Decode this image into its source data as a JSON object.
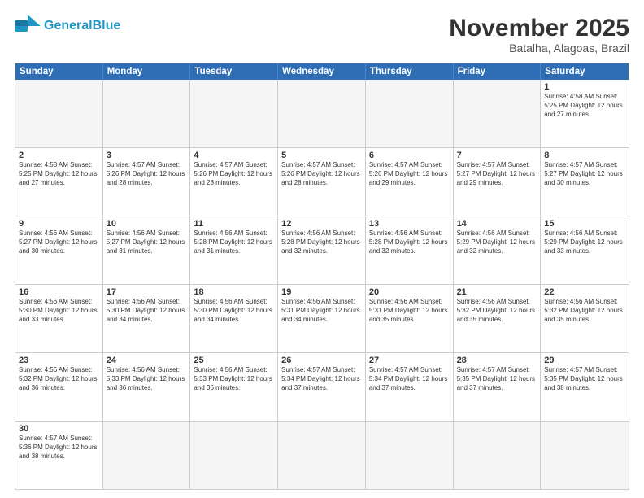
{
  "header": {
    "logo_general": "General",
    "logo_blue": "Blue",
    "month_year": "November 2025",
    "location": "Batalha, Alagoas, Brazil"
  },
  "weekdays": [
    "Sunday",
    "Monday",
    "Tuesday",
    "Wednesday",
    "Thursday",
    "Friday",
    "Saturday"
  ],
  "rows": [
    [
      {
        "day": "",
        "text": ""
      },
      {
        "day": "",
        "text": ""
      },
      {
        "day": "",
        "text": ""
      },
      {
        "day": "",
        "text": ""
      },
      {
        "day": "",
        "text": ""
      },
      {
        "day": "",
        "text": ""
      },
      {
        "day": "1",
        "text": "Sunrise: 4:58 AM\nSunset: 5:25 PM\nDaylight: 12 hours and 27 minutes."
      }
    ],
    [
      {
        "day": "2",
        "text": "Sunrise: 4:58 AM\nSunset: 5:25 PM\nDaylight: 12 hours and 27 minutes."
      },
      {
        "day": "3",
        "text": "Sunrise: 4:57 AM\nSunset: 5:26 PM\nDaylight: 12 hours and 28 minutes."
      },
      {
        "day": "4",
        "text": "Sunrise: 4:57 AM\nSunset: 5:26 PM\nDaylight: 12 hours and 28 minutes."
      },
      {
        "day": "5",
        "text": "Sunrise: 4:57 AM\nSunset: 5:26 PM\nDaylight: 12 hours and 28 minutes."
      },
      {
        "day": "6",
        "text": "Sunrise: 4:57 AM\nSunset: 5:26 PM\nDaylight: 12 hours and 29 minutes."
      },
      {
        "day": "7",
        "text": "Sunrise: 4:57 AM\nSunset: 5:27 PM\nDaylight: 12 hours and 29 minutes."
      },
      {
        "day": "8",
        "text": "Sunrise: 4:57 AM\nSunset: 5:27 PM\nDaylight: 12 hours and 30 minutes."
      }
    ],
    [
      {
        "day": "9",
        "text": "Sunrise: 4:56 AM\nSunset: 5:27 PM\nDaylight: 12 hours and 30 minutes."
      },
      {
        "day": "10",
        "text": "Sunrise: 4:56 AM\nSunset: 5:27 PM\nDaylight: 12 hours and 31 minutes."
      },
      {
        "day": "11",
        "text": "Sunrise: 4:56 AM\nSunset: 5:28 PM\nDaylight: 12 hours and 31 minutes."
      },
      {
        "day": "12",
        "text": "Sunrise: 4:56 AM\nSunset: 5:28 PM\nDaylight: 12 hours and 32 minutes."
      },
      {
        "day": "13",
        "text": "Sunrise: 4:56 AM\nSunset: 5:28 PM\nDaylight: 12 hours and 32 minutes."
      },
      {
        "day": "14",
        "text": "Sunrise: 4:56 AM\nSunset: 5:29 PM\nDaylight: 12 hours and 32 minutes."
      },
      {
        "day": "15",
        "text": "Sunrise: 4:56 AM\nSunset: 5:29 PM\nDaylight: 12 hours and 33 minutes."
      }
    ],
    [
      {
        "day": "16",
        "text": "Sunrise: 4:56 AM\nSunset: 5:30 PM\nDaylight: 12 hours and 33 minutes."
      },
      {
        "day": "17",
        "text": "Sunrise: 4:56 AM\nSunset: 5:30 PM\nDaylight: 12 hours and 34 minutes."
      },
      {
        "day": "18",
        "text": "Sunrise: 4:56 AM\nSunset: 5:30 PM\nDaylight: 12 hours and 34 minutes."
      },
      {
        "day": "19",
        "text": "Sunrise: 4:56 AM\nSunset: 5:31 PM\nDaylight: 12 hours and 34 minutes."
      },
      {
        "day": "20",
        "text": "Sunrise: 4:56 AM\nSunset: 5:31 PM\nDaylight: 12 hours and 35 minutes."
      },
      {
        "day": "21",
        "text": "Sunrise: 4:56 AM\nSunset: 5:32 PM\nDaylight: 12 hours and 35 minutes."
      },
      {
        "day": "22",
        "text": "Sunrise: 4:56 AM\nSunset: 5:32 PM\nDaylight: 12 hours and 35 minutes."
      }
    ],
    [
      {
        "day": "23",
        "text": "Sunrise: 4:56 AM\nSunset: 5:32 PM\nDaylight: 12 hours and 36 minutes."
      },
      {
        "day": "24",
        "text": "Sunrise: 4:56 AM\nSunset: 5:33 PM\nDaylight: 12 hours and 36 minutes."
      },
      {
        "day": "25",
        "text": "Sunrise: 4:56 AM\nSunset: 5:33 PM\nDaylight: 12 hours and 36 minutes."
      },
      {
        "day": "26",
        "text": "Sunrise: 4:57 AM\nSunset: 5:34 PM\nDaylight: 12 hours and 37 minutes."
      },
      {
        "day": "27",
        "text": "Sunrise: 4:57 AM\nSunset: 5:34 PM\nDaylight: 12 hours and 37 minutes."
      },
      {
        "day": "28",
        "text": "Sunrise: 4:57 AM\nSunset: 5:35 PM\nDaylight: 12 hours and 37 minutes."
      },
      {
        "day": "29",
        "text": "Sunrise: 4:57 AM\nSunset: 5:35 PM\nDaylight: 12 hours and 38 minutes."
      }
    ],
    [
      {
        "day": "30",
        "text": "Sunrise: 4:57 AM\nSunset: 5:36 PM\nDaylight: 12 hours and 38 minutes."
      },
      {
        "day": "",
        "text": ""
      },
      {
        "day": "",
        "text": ""
      },
      {
        "day": "",
        "text": ""
      },
      {
        "day": "",
        "text": ""
      },
      {
        "day": "",
        "text": ""
      },
      {
        "day": "",
        "text": ""
      }
    ]
  ]
}
